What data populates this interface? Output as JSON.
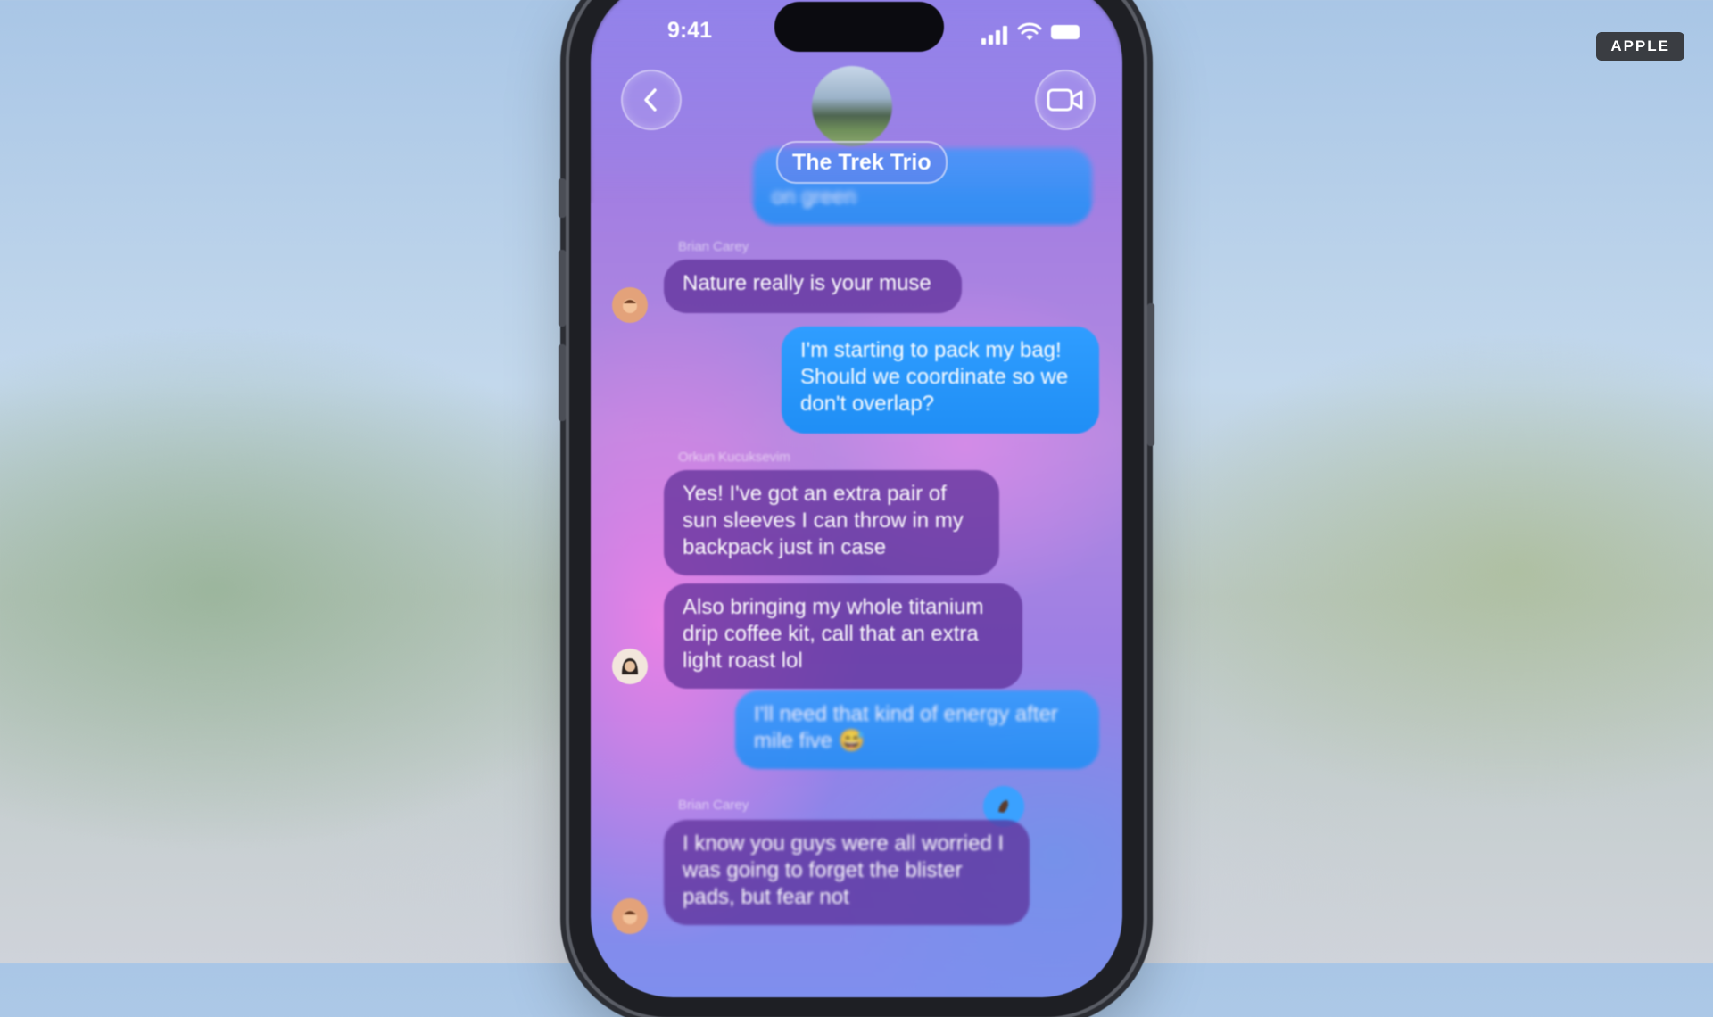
{
  "watermark": "APPLE",
  "status_bar": {
    "time": "9:41"
  },
  "header": {
    "group_name": "The Trek Trio"
  },
  "icons": {
    "back": "chevron-left-icon",
    "video": "video-camera-icon"
  },
  "colors": {
    "outgoing_bubble": "#1f8ef5",
    "incoming_bubble": "#5c2c96"
  },
  "messages": [
    {
      "direction": "outgoing",
      "text": "on green"
    },
    {
      "direction": "incoming",
      "sender": "Brian Carey",
      "text": "Nature really is your muse"
    },
    {
      "direction": "outgoing",
      "text": "I'm starting to pack my bag! Should we coordinate so we don't overlap?"
    },
    {
      "direction": "incoming",
      "sender": "Orkun Kucuksevim",
      "text": "Yes! I've got an extra pair of sun sleeves I can throw in my backpack just in case"
    },
    {
      "direction": "incoming",
      "text": "Also bringing my whole titanium drip coffee kit, call that an extra light roast lol"
    },
    {
      "direction": "outgoing",
      "text": "I'll need that kind of energy after mile five 😅"
    },
    {
      "direction": "incoming",
      "sender": "Brian Carey",
      "text": "I know you guys were all worried I was going to forget the blister pads, but fear not"
    }
  ]
}
